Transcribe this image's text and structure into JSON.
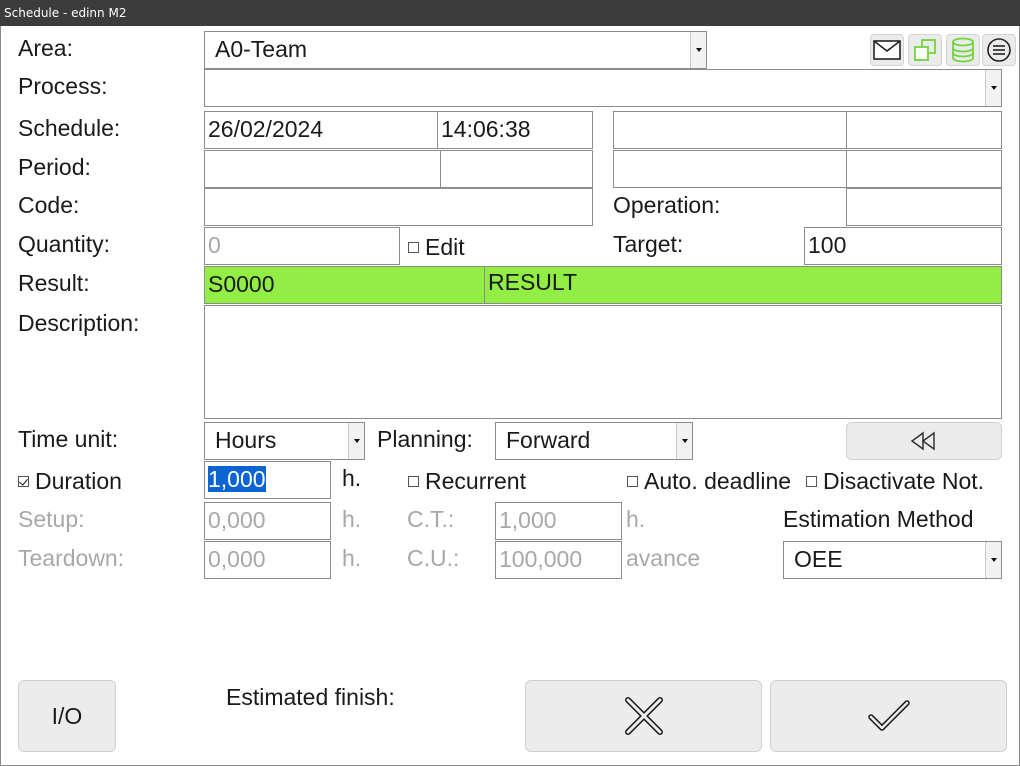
{
  "window": {
    "title": "Schedule - edinn M2"
  },
  "labels": {
    "area": "Area:",
    "process": "Process:",
    "schedule": "Schedule:",
    "period": "Period:",
    "code": "Code:",
    "operation": "Operation:",
    "quantity": "Quantity:",
    "target": "Target:",
    "result": "Result:",
    "description": "Description:",
    "time_unit": "Time unit:",
    "planning": "Planning:",
    "setup": "Setup:",
    "teardown": "Teardown:",
    "ct": "C.T.:",
    "cu": "C.U.:",
    "estimation_method": "Estimation Method",
    "estimated_finish": "Estimated finish:"
  },
  "fields": {
    "area": "A0-Team",
    "process": "",
    "schedule_date": "26/02/2024",
    "schedule_time": "14:06:38",
    "schedule_extra_1": "",
    "schedule_extra_2": "",
    "period_start": "",
    "period_end": "",
    "period_extra_1": "",
    "period_extra_2": "",
    "code": "",
    "operation": "",
    "quantity": "0",
    "target": "100",
    "result_code": "S0000",
    "result_text": "RESULT",
    "description": "",
    "time_unit": "Hours",
    "planning": "Forward",
    "duration": "1,000",
    "setup": "0,000",
    "teardown": "0,000",
    "ct": "1,000",
    "cu": "100,000",
    "estimation_method": "OEE"
  },
  "units": {
    "duration": "h.",
    "setup": "h.",
    "teardown": "h.",
    "ct": "h.",
    "cu": "avance"
  },
  "checkboxes": {
    "edit": {
      "label": "Edit",
      "checked": false
    },
    "duration": {
      "label": "Duration",
      "checked": true
    },
    "recurrent": {
      "label": "Recurrent",
      "checked": false
    },
    "auto_deadline": {
      "label": "Auto. deadline",
      "checked": false
    },
    "disactivate_not": {
      "label": "Disactivate Not.",
      "checked": false
    }
  },
  "buttons": {
    "io": "I/O"
  },
  "toolbar_icons": [
    "mail-icon",
    "copy-icon",
    "database-icon",
    "menu-icon"
  ],
  "colors": {
    "result_bg": "#92ed44",
    "selection": "#0a64d2",
    "titlebar": "#3c3c3c"
  }
}
